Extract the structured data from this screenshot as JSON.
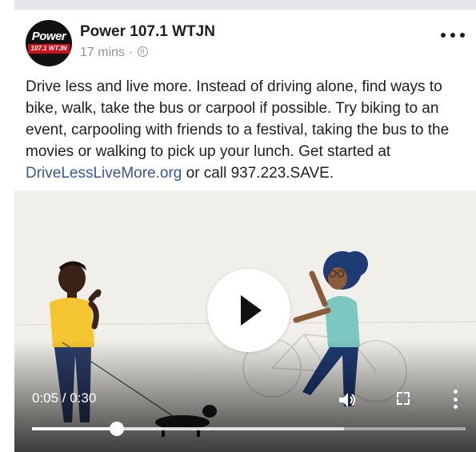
{
  "post": {
    "page_name": "Power 107.1 WTJN",
    "time_ago": "17 mins",
    "separator": "·",
    "privacy_icon": "globe-icon",
    "avatar": {
      "logo_text": "Power",
      "band_text": "107.1 WTJN"
    },
    "text_main": "Drive less and live more. Instead of driving alone, find ways to bike, walk, take the bus or carpool if possible. Try biking to an event, carpooling with friends to a festival, taking the bus to the movies or walking to pick up your lunch. Get started at ",
    "link_text": "DriveLessLiveMore.org",
    "text_end": " or call 937.223.SAVE.",
    "more_icon": "more-horizontal-icon"
  },
  "video": {
    "time_display": "0:05 / 0:30",
    "progress_fraction": 0.195,
    "buffered_fraction": 0.72,
    "play_icon": "play-icon",
    "volume_icon": "volume-icon",
    "fullscreen_icon": "fullscreen-icon",
    "menu_icon": "more-vertical-icon"
  },
  "colors": {
    "link": "#385898",
    "meta": "#8d949e",
    "video_bg": "#f1efe9",
    "shirt_yellow": "#f4c531",
    "shirt_teal": "#7cc7bf"
  }
}
